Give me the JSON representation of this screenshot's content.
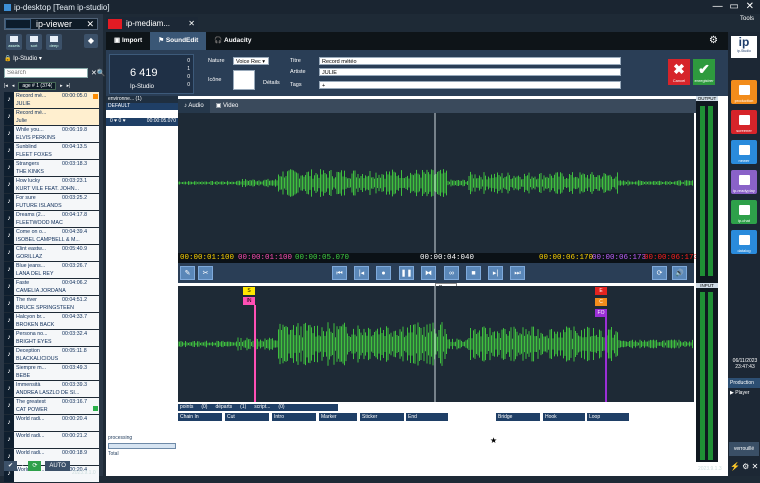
{
  "window": {
    "title": "ip-desktop [Team ip-studio]",
    "tools": "Tools"
  },
  "left": {
    "tab_title": "ip-viewer",
    "tools": [
      "assets",
      "sort",
      "deep"
    ],
    "studio": "Ip-Studio",
    "search_placeholder": "Search",
    "page_label": "age # 1 (374(",
    "version": "2023.9.1.0",
    "footer": [
      "1",
      "AUTO"
    ]
  },
  "playlist": [
    {
      "t": "Record mé...",
      "d": "00:00:05.0",
      "a": "JULIE",
      "sel": true
    },
    {
      "t": "Record mé...",
      "d": "",
      "a": "Julie",
      "sel": true
    },
    {
      "t": "While you...",
      "d": "00:06:19.8",
      "a": "ELVIS PERKINS"
    },
    {
      "t": "Sunblind",
      "d": "00:04:13.5",
      "a": "FLEET FOXES"
    },
    {
      "t": "Strangers",
      "d": "00:03:18.3",
      "a": "THE KINKS"
    },
    {
      "t": "How lucky",
      "d": "00:03:23.1",
      "a": "KURT VILE FEAT. JOHN..."
    },
    {
      "t": "For sure",
      "d": "00:03:25.2",
      "a": "FUTURE ISLANDS"
    },
    {
      "t": "Dreams (2...",
      "d": "00:04:17.8",
      "a": "FLEETWOOD MAC"
    },
    {
      "t": "Come on o...",
      "d": "00:04:39.4",
      "a": "ISOBEL CAMPBELL & M..."
    },
    {
      "t": "Clint eastw...",
      "d": "00:05:40.9",
      "a": "GORILLAZ"
    },
    {
      "t": "Blue jeans...",
      "d": "00:03:26.7",
      "a": "LANA DEL REY"
    },
    {
      "t": "Faste",
      "d": "00:04:06.2",
      "a": "CAMÉLIA JORDANA"
    },
    {
      "t": "The river",
      "d": "00:04:51.2",
      "a": "BRUCE SPRINGSTEEN"
    },
    {
      "t": "Halcyon br...",
      "d": "00:04:33.7",
      "a": "BROKEN BACK"
    },
    {
      "t": "Persona no...",
      "d": "00:03:32.4",
      "a": "BRIGHT EYES"
    },
    {
      "t": "Deception",
      "d": "00:05:11.8",
      "a": "BLACKALICIOUS"
    },
    {
      "t": "Siempre m...",
      "d": "00:03:49.3",
      "a": "BEBE"
    },
    {
      "t": "Immensità",
      "d": "00:03:39.3",
      "a": "ANDREA LASZLO DE SI..."
    },
    {
      "t": "The greatest",
      "d": "00:03:16.7",
      "a": "CAT POWER"
    },
    {
      "t": "World radi...",
      "d": "00:00:20.4",
      "a": ""
    },
    {
      "t": "World radi...",
      "d": "00:00:21.2",
      "a": ""
    },
    {
      "t": "World radi...",
      "d": "00:00:18.9",
      "a": ""
    },
    {
      "t": "World radi...",
      "d": "00:00:20.4",
      "a": ""
    }
  ],
  "main": {
    "tab": "ip-mediam...",
    "tabs": [
      "Import",
      "SoundEdit",
      "Audacity"
    ],
    "counter": "6 419",
    "counter_studio": "Ip-Studio",
    "counter_side": [
      "0",
      "1",
      "0",
      "0"
    ],
    "nature_label": "Nature",
    "nature_value": "Voice Rec",
    "icone_label": "Icône",
    "details": "Détails",
    "titre_label": "Titre",
    "titre_value": "Record météo",
    "artiste_label": "Artiste",
    "artiste_value": "JULIE",
    "tags_label": "Tags",
    "tags_value": "+",
    "cancel": "Cancel",
    "save": "enregistrer"
  },
  "categories": {
    "head": "environne...",
    "count": "(1)",
    "row": "DEFAULT",
    "row2": "0 ♥  0 ♥",
    "row2_time": "00:00:05.070",
    "processing": "processing",
    "total": "Total"
  },
  "subtabs": [
    "Audio",
    "Video"
  ],
  "timebar": {
    "t1": "00:00:01:100",
    "t2": "00:00:01:100",
    "t3": "00:00:05.070",
    "center": "00:00:04:040",
    "r1": "00:00:06:170",
    "r2": "00:00:06:173",
    "r3": "00:00:06:173"
  },
  "tooltip": "Pause",
  "markers_top": [
    "S",
    "IN"
  ],
  "markers_right": [
    "E",
    "C",
    "FO"
  ],
  "marker_tabs": [
    "points",
    "(0)",
    "départs",
    "(1)",
    "script...",
    "(0)"
  ],
  "marker_types": [
    "Chain In",
    "Cut",
    "Intro",
    "Marker",
    "Sticker",
    "End",
    "Bridge",
    "Hook",
    "Loop"
  ],
  "meters": {
    "output": "OUTPUT",
    "input": "INPUT"
  },
  "right": {
    "logo": "ip",
    "logo_sub": "ip-Studio",
    "buttons": [
      "production",
      "screener",
      "newer",
      "ip-readyplay",
      "ip-chat",
      "datalog"
    ],
    "date": "06/11/2023",
    "time": "23:47:43",
    "production": "Production",
    "player": "Player",
    "verrouille": "verrouillé",
    "version": "2023.9.1.3"
  },
  "colors": {
    "accent": "#3a5776",
    "cancel": "#d6242a",
    "save": "#2e9a3e",
    "wave": "#3fbf3f",
    "orange": "#f28c1b"
  }
}
